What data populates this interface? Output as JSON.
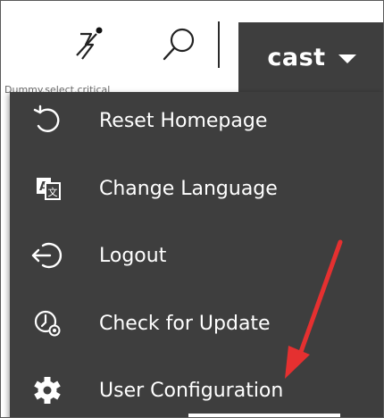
{
  "toolbar": {
    "notification_icon": "notification-off-icon",
    "search_icon": "search-icon",
    "user_name": "cast",
    "underlay_text": "Dummy.select.critical"
  },
  "menu": {
    "items": [
      {
        "label": "Reset Homepage",
        "icon": "reset-icon"
      },
      {
        "label": "Change Language",
        "icon": "language-icon"
      },
      {
        "label": "Logout",
        "icon": "logout-icon"
      },
      {
        "label": "Check for Update",
        "icon": "update-clock-icon"
      },
      {
        "label": "User Configuration",
        "icon": "gear-icon"
      }
    ]
  },
  "colors": {
    "menu_background": "#3e3e3e",
    "menu_text": "#ffffff",
    "annotation_arrow": "#e53030"
  }
}
